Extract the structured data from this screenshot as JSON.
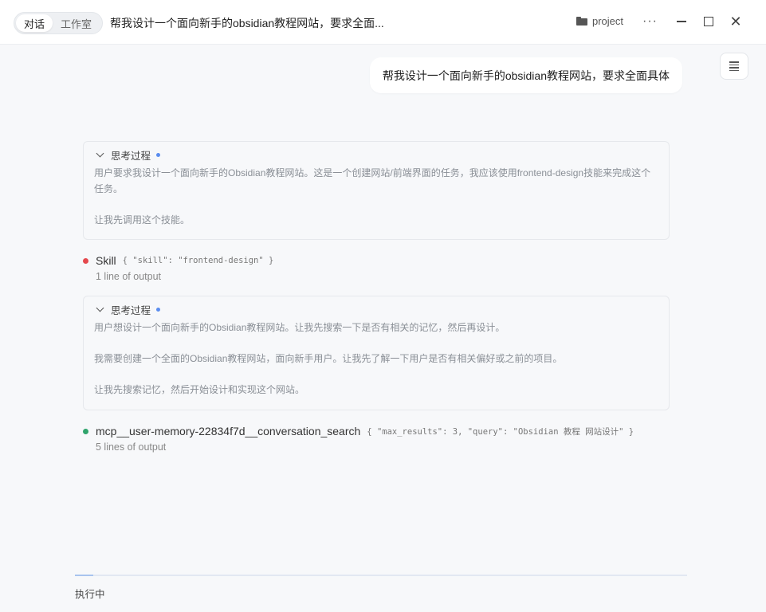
{
  "titlebar": {
    "tabs": [
      {
        "label": "对话",
        "active": true
      },
      {
        "label": "工作室",
        "active": false
      }
    ],
    "title": "帮我设计一个面向新手的obsidian教程网站，要求全面...",
    "project_label": "project",
    "more_label": "···",
    "close_label": "✕"
  },
  "user_message": "帮我设计一个面向新手的obsidian教程网站，要求全面具体",
  "thinking": [
    {
      "label": "思考过程",
      "lines": [
        "用户要求我设计一个面向新手的Obsidian教程网站。这是一个创建网站/前端界面的任务，我应该使用frontend-design技能来完成这个任务。",
        "让我先调用这个技能。"
      ]
    },
    {
      "label": "思考过程",
      "lines": [
        "用户想设计一个面向新手的Obsidian教程网站。让我先搜索一下是否有相关的记忆，然后再设计。",
        "我需要创建一个全面的Obsidian教程网站，面向新手用户。让我先了解一下用户是否有相关偏好或之前的项目。",
        "让我先搜索记忆，然后开始设计和实现这个网站。"
      ]
    }
  ],
  "tools": [
    {
      "name": "Skill",
      "args": "{ \"skill\": \"frontend-design\" }",
      "output": "1 line of output",
      "status_color": "#e5484d"
    },
    {
      "name": "mcp__user-memory-22834f7d__conversation_search",
      "args": "{ \"max_results\": 3, \"query\": \"Obsidian 教程 网站设计\" }",
      "output": "5 lines of output",
      "status_color": "#30a46c"
    }
  ],
  "status": {
    "text": "执行中",
    "progress": 0.03
  },
  "colors": {
    "accent": "#5b8def"
  }
}
